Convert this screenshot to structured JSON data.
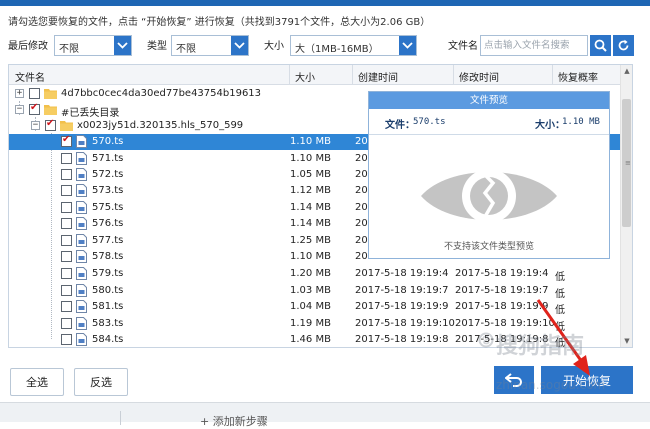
{
  "header": {
    "hint": "请勾选您要恢复的文件，点击 “开始恢复” 进行恢复（共找到3791个文件，总大小为2.06 GB）"
  },
  "filters": {
    "modified": {
      "label": "最后修改",
      "value": "不限"
    },
    "type": {
      "label": "类型",
      "value": "不限"
    },
    "size": {
      "label": "大小",
      "value": "大（1MB-16MB）"
    },
    "filename": {
      "label": "文件名",
      "placeholder": "点击输入文件名搜索"
    }
  },
  "table": {
    "columns": [
      "文件名",
      "大小",
      "创建时间",
      "修改时间",
      "恢复概率"
    ],
    "tree": {
      "folder1": "4d7bbc0cec4da30ed77be43754b19613",
      "folder2": "#已丢失目录",
      "folder3": "x0023jy51d.320135.hls_570_599"
    },
    "rows": [
      {
        "name": "570.ts",
        "size": "1.10 MB",
        "created": "20",
        "modified": "",
        "prob": ""
      },
      {
        "name": "571.ts",
        "size": "1.10 MB",
        "created": "20",
        "modified": "",
        "prob": ""
      },
      {
        "name": "572.ts",
        "size": "1.05 MB",
        "created": "20",
        "modified": "",
        "prob": ""
      },
      {
        "name": "573.ts",
        "size": "1.12 MB",
        "created": "20",
        "modified": "",
        "prob": ""
      },
      {
        "name": "575.ts",
        "size": "1.14 MB",
        "created": "20",
        "modified": "",
        "prob": ""
      },
      {
        "name": "576.ts",
        "size": "1.14 MB",
        "created": "20",
        "modified": "",
        "prob": ""
      },
      {
        "name": "577.ts",
        "size": "1.25 MB",
        "created": "20",
        "modified": "",
        "prob": ""
      },
      {
        "name": "578.ts",
        "size": "1.10 MB",
        "created": "20",
        "modified": "",
        "prob": ""
      },
      {
        "name": "579.ts",
        "size": "1.20 MB",
        "created": "2017-5-18 19:19:4",
        "modified": "2017-5-18 19:19:4",
        "prob": "低"
      },
      {
        "name": "580.ts",
        "size": "1.03 MB",
        "created": "2017-5-18 19:19:7",
        "modified": "2017-5-18 19:19:7",
        "prob": "低"
      },
      {
        "name": "581.ts",
        "size": "1.04 MB",
        "created": "2017-5-18 19:19:9",
        "modified": "2017-5-18 19:19:9",
        "prob": "低"
      },
      {
        "name": "583.ts",
        "size": "1.19 MB",
        "created": "2017-5-18 19:19:10",
        "modified": "2017-5-18 19:19:10",
        "prob": "低"
      },
      {
        "name": "584.ts",
        "size": "1.46 MB",
        "created": "2017-5-18 19:19:8",
        "modified": "2017-5-18 19:19:8",
        "prob": "低"
      }
    ]
  },
  "preview": {
    "title": "文件预览",
    "file_label": "文件：",
    "file_value": "570.ts",
    "size_label": "大小：",
    "size_value": "1.10 MB",
    "message": "不支持该文件类型预览"
  },
  "buttons": {
    "select_all": "全选",
    "invert": "反选",
    "start": "开始恢复"
  },
  "footer": {
    "add_step": "+ 添加新步骤"
  },
  "watermark": {
    "cn": "搜狗指南",
    "url": "zhinan.sogou.com"
  },
  "colors": {
    "accent": "#2c74c8",
    "selected_row": "#2f86d6",
    "check": "#d0161c"
  }
}
